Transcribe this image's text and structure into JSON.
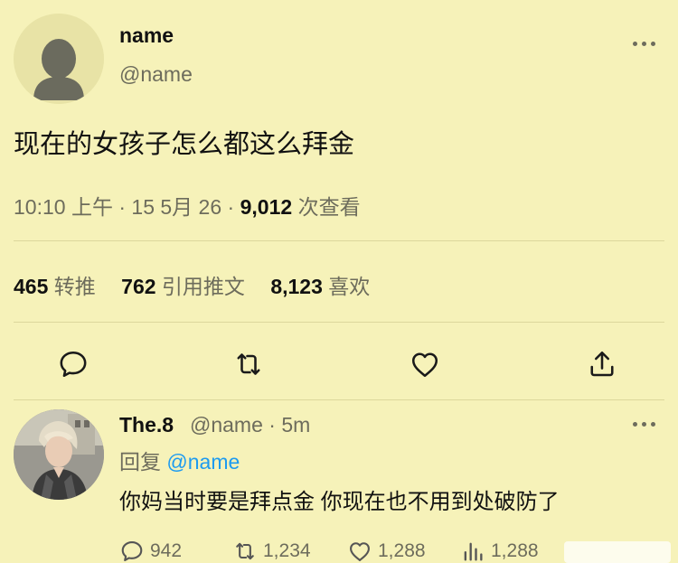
{
  "tweet": {
    "author_name": "name",
    "author_handle": "@name",
    "text": "现在的女孩子怎么都这么拜金",
    "time": "10:10 上午",
    "date": "15 5月 26",
    "separator": "·",
    "views_count": "9,012",
    "views_label": "次查看",
    "retweets_count": "465",
    "retweets_label": "转推",
    "quotes_count": "762",
    "quotes_label": "引用推文",
    "likes_count": "8,123",
    "likes_label": "喜欢"
  },
  "reply": {
    "author_name": "The.8",
    "author_handle": "@name",
    "time": "· 5m",
    "reply_label": "回复",
    "reply_mention": "@name",
    "text": "你妈当时要是拜点金 你现在也不用到处破防了",
    "comments": "942",
    "retweets": "1,234",
    "likes": "1,288",
    "views": "1,288"
  },
  "icons": {
    "reply": "comment-icon",
    "retweet": "retweet-icon",
    "like": "heart-icon",
    "share": "share-icon",
    "views": "views-chart-icon",
    "more": "more-horizontal-icon"
  },
  "colors": {
    "background": "#f6f2b9",
    "secondary_text": "#6d6c5c",
    "link": "#1d9bf0"
  }
}
